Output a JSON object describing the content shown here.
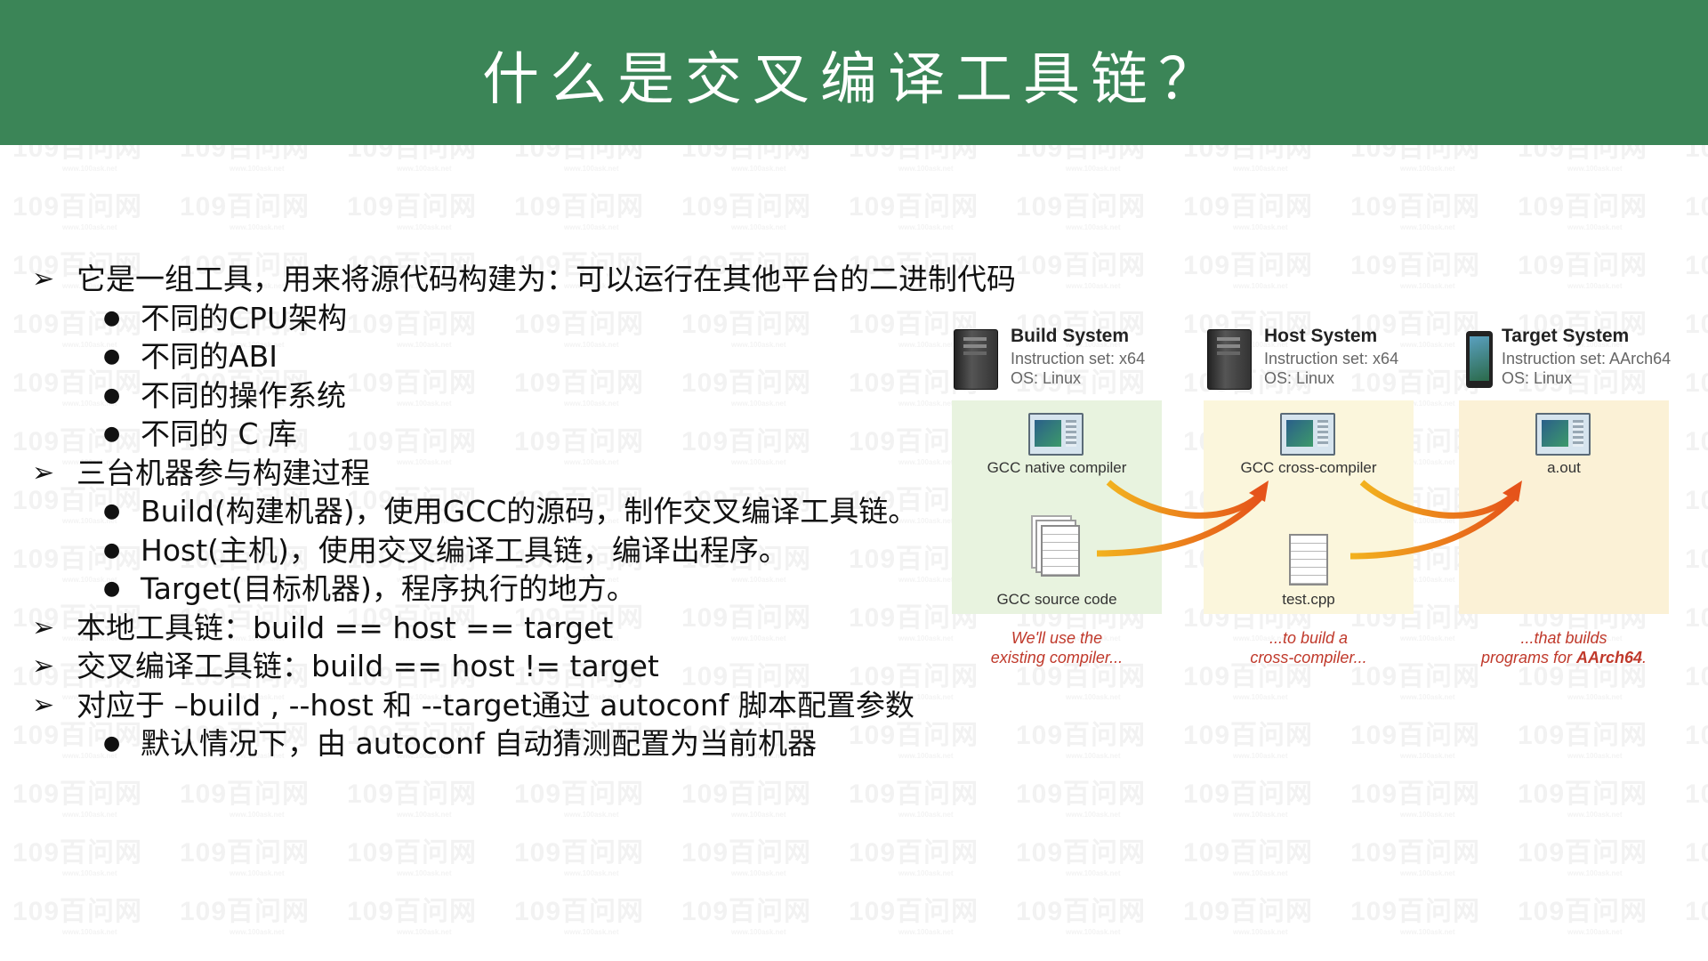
{
  "slide": {
    "title": "什么是交叉编译工具链？"
  },
  "bullets": [
    {
      "level": 1,
      "marker": "➢",
      "text": "它是一组工具，用来将源代码构建为：可以运行在其他平台的二进制代码"
    },
    {
      "level": 2,
      "marker": "●",
      "text": "不同的CPU架构"
    },
    {
      "level": 2,
      "marker": "●",
      "text": "不同的ABI"
    },
    {
      "level": 2,
      "marker": "●",
      "text": "不同的操作系统"
    },
    {
      "level": 2,
      "marker": "●",
      "text": "不同的 C 库"
    },
    {
      "level": 1,
      "marker": "➢",
      "text": " 三台机器参与构建过程"
    },
    {
      "level": 2,
      "marker": "●",
      "text": "Build(构建机器)，使用GCC的源码，制作交叉编译工具链。"
    },
    {
      "level": 2,
      "marker": "●",
      "text": "Host(主机)，使用交叉编译工具链，编译出程序。"
    },
    {
      "level": 2,
      "marker": "●",
      "text": "Target(目标机器)，程序执行的地方。"
    },
    {
      "level": 1,
      "marker": "➢",
      "text": "本地工具链：build == host == target"
    },
    {
      "level": 1,
      "marker": "➢",
      "text": "交叉编译工具链：build == host != target"
    },
    {
      "level": 1,
      "marker": "➢",
      "text": "对应于 –build , --host 和 --target通过 autoconf  脚本配置参数"
    },
    {
      "level": 2,
      "marker": "●",
      "text": "默认情况下，由 autoconf 自动猜测配置为当前机器"
    }
  ],
  "diagram": {
    "build": {
      "name": "Build System",
      "instruction_set": "Instruction set: x64",
      "os": "OS: Linux",
      "top_label": "GCC native compiler",
      "bottom_label": "GCC source code",
      "caption_line1": "We'll use the",
      "caption_line2": "existing compiler..."
    },
    "host": {
      "name": "Host System",
      "instruction_set": "Instruction set: x64",
      "os": "OS: Linux",
      "top_label": "GCC cross-compiler",
      "bottom_label": "test.cpp",
      "caption_line1": "...to build a",
      "caption_line2": "cross-compiler..."
    },
    "target": {
      "name": "Target System",
      "instruction_set": "Instruction set: AArch64",
      "os": "OS: Linux",
      "top_label": "a.out",
      "caption_line1": "...that builds",
      "caption_line2_prefix": "programs for ",
      "caption_line2_bold": "AArch64",
      "caption_line2_suffix": "."
    }
  },
  "watermark": {
    "text": "109百问网",
    "subtext": "www.100ask.net"
  },
  "colors": {
    "header_bg": "#3b8557",
    "arrow": "#e8741a",
    "caption": "#c0392b"
  }
}
